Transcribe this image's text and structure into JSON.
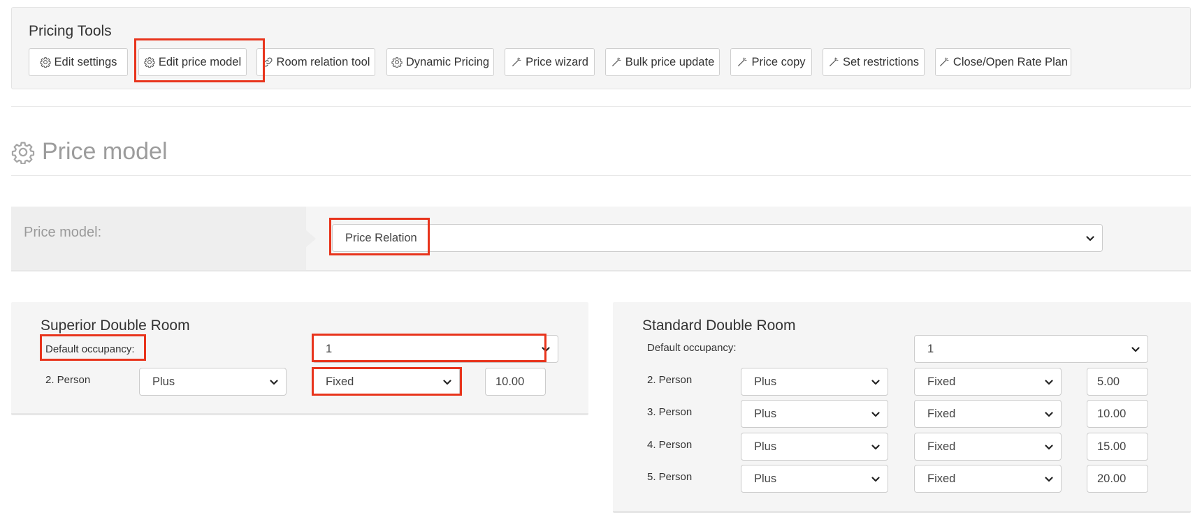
{
  "pricing_tools": {
    "title": "Pricing Tools",
    "buttons": [
      {
        "label": "Edit settings",
        "icon": "gear-icon"
      },
      {
        "label": "Edit price model",
        "icon": "gear-icon"
      },
      {
        "label": "Room relation tool",
        "icon": "link-icon"
      },
      {
        "label": "Dynamic Pricing",
        "icon": "gear-icon"
      },
      {
        "label": "Price wizard",
        "icon": "magic-wand-icon"
      },
      {
        "label": "Bulk price update",
        "icon": "magic-wand-icon"
      },
      {
        "label": "Price copy",
        "icon": "magic-wand-icon"
      },
      {
        "label": "Set restrictions",
        "icon": "magic-wand-icon"
      },
      {
        "label": "Close/Open Rate Plan",
        "icon": "magic-wand-icon"
      }
    ]
  },
  "page_title": "Price model",
  "price_model_row": {
    "label": "Price model:",
    "selected": "Price Relation"
  },
  "rooms": [
    {
      "name": "Superior Double Room",
      "default_occupancy_label": "Default occupancy:",
      "default_occupancy": "1",
      "persons": [
        {
          "label": "2. Person",
          "operator": "Plus",
          "type": "Fixed",
          "amount": "10.00"
        }
      ]
    },
    {
      "name": "Standard Double Room",
      "default_occupancy_label": "Default occupancy:",
      "default_occupancy": "1",
      "persons": [
        {
          "label": "2. Person",
          "operator": "Plus",
          "type": "Fixed",
          "amount": "5.00"
        },
        {
          "label": "3. Person",
          "operator": "Plus",
          "type": "Fixed",
          "amount": "10.00"
        },
        {
          "label": "4. Person",
          "operator": "Plus",
          "type": "Fixed",
          "amount": "15.00"
        },
        {
          "label": "5. Person",
          "operator": "Plus",
          "type": "Fixed",
          "amount": "20.00"
        }
      ]
    }
  ],
  "colors": {
    "highlight": "#e8341c",
    "panel_bg": "#f5f5f5"
  }
}
